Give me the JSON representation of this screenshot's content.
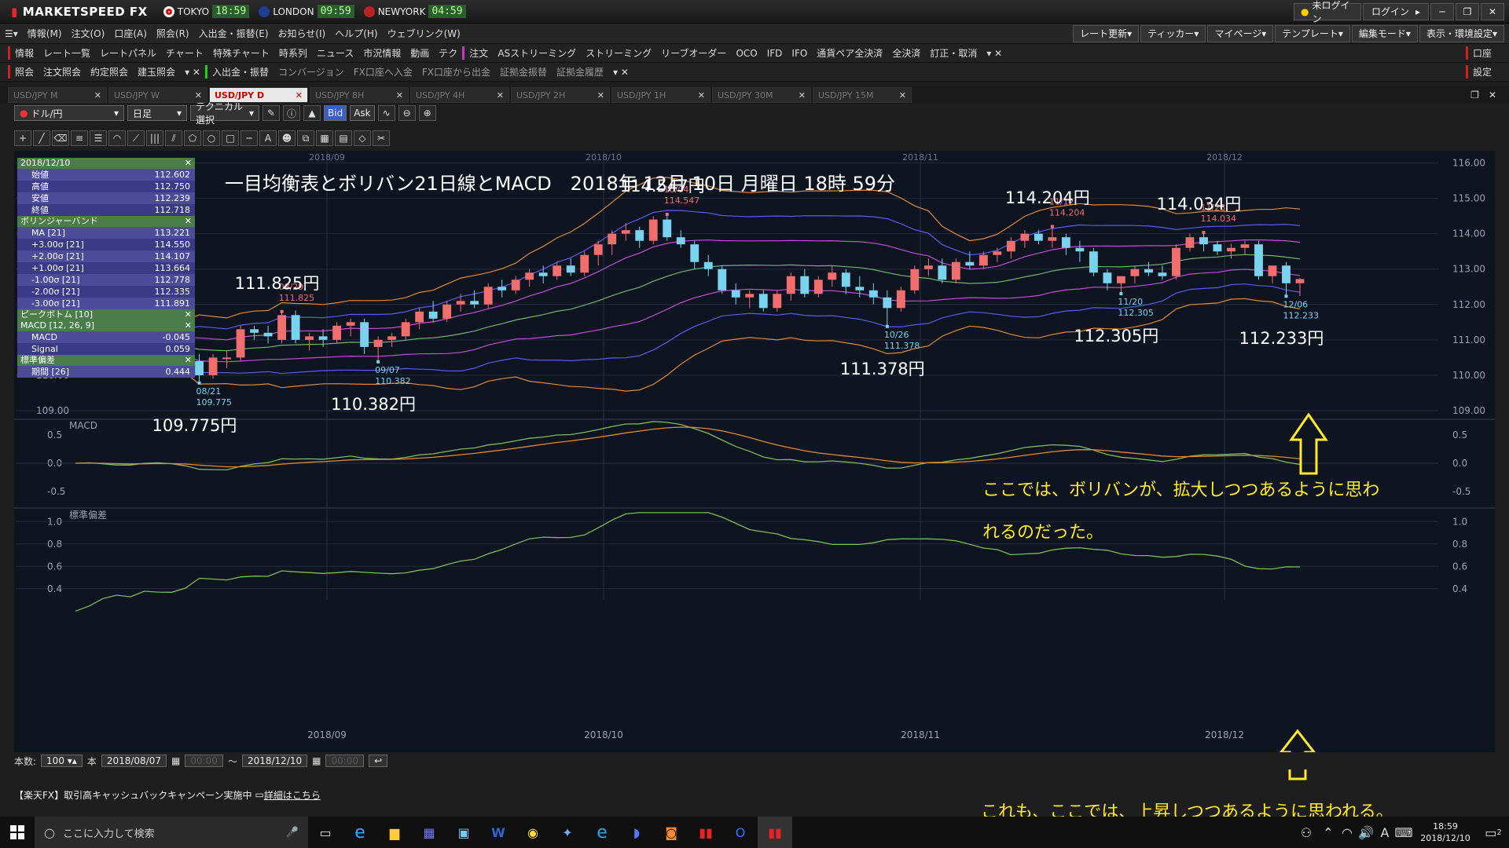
{
  "titlebar": {
    "app": "MARKETSPEED FX",
    "cities": [
      {
        "name": "TOKYO",
        "time": "18:59"
      },
      {
        "name": "LONDON",
        "time": "09:59"
      },
      {
        "name": "NEWYORK",
        "time": "04:59"
      }
    ],
    "login_status": "未ログイン",
    "login": "ログイン"
  },
  "menu": [
    "情報(M)",
    "注文(O)",
    "口座(A)",
    "照会(R)",
    "入出金・振替(E)",
    "お知らせ(I)",
    "ヘルプ(H)",
    "ウェブリンク(W)"
  ],
  "menu_right": [
    "レート更新",
    "ティッカー",
    "マイページ",
    "テンプレート",
    "編集モード",
    "表示・環境設定"
  ],
  "toolbar2": [
    "情報",
    "レート一覧",
    "レートパネル",
    "チャート",
    "特殊チャート",
    "時系列",
    "ニュース",
    "市況情報",
    "動画",
    "テク",
    "注文",
    "ASストリーミング",
    "ストリーミング",
    "リーブオーダー",
    "OCO",
    "IFD",
    "IFO",
    "通貨ペア全決済",
    "全決済",
    "訂正・取消"
  ],
  "toolbar2_right": "口座",
  "toolbar3": [
    "照会",
    "注文照会",
    "約定照会",
    "建玉照会",
    "入出金・振替",
    "コンバージョン",
    "FX口座へ入金",
    "FX口座から出金",
    "証拠金振替",
    "証拠金履歴"
  ],
  "toolbar3_right": "設定",
  "tabs": [
    "USD/JPY M",
    "USD/JPY W",
    "USD/JPY D",
    "USD/JPY 8H",
    "USD/JPY 4H",
    "USD/JPY 2H",
    "USD/JPY 1H",
    "USD/JPY 30M",
    "USD/JPY 15M"
  ],
  "active_tab": 2,
  "chart_toolbar": {
    "pair": "ドル/円",
    "period": "日足",
    "tech": "テクニカル選択",
    "bid": "Bid",
    "ask": "Ask"
  },
  "heading": "一目均衡表とボリバン21日線とMACD　2018年 12月 10日 月曜日 18時 59分",
  "info": {
    "date": "2018/12/10",
    "ohlc": [
      [
        "始値",
        "112.602"
      ],
      [
        "高値",
        "112.750"
      ],
      [
        "安値",
        "112.239"
      ],
      [
        "終値",
        "112.718"
      ]
    ],
    "bb_title": "ボリンジャーバンド",
    "bb": [
      [
        "MA [21]",
        "113.221"
      ],
      [
        "+3.00σ [21]",
        "114.550"
      ],
      [
        "+2.00σ [21]",
        "114.107"
      ],
      [
        "+1.00σ [21]",
        "113.664"
      ],
      [
        "-1.00σ [21]",
        "112.778"
      ],
      [
        "-2.00σ [21]",
        "112.335"
      ],
      [
        "-3.00σ [21]",
        "111.891"
      ]
    ],
    "pb_title": "ピークボトム [10]",
    "macd_title": "MACD [12, 26, 9]",
    "macd": [
      [
        "MACD",
        "-0.045"
      ],
      [
        "Signal",
        "0.059"
      ]
    ],
    "sd_title": "標準偏差",
    "sd": [
      [
        "期間 [26]",
        "0.444"
      ]
    ]
  },
  "x_labels": [
    "2018/09",
    "2018/10",
    "2018/11",
    "2018/12"
  ],
  "price_ticks": [
    "116.00",
    "115.00",
    "114.00",
    "113.00",
    "112.00",
    "111.00",
    "110.00",
    "109.00"
  ],
  "macd_label": "MACD",
  "macd_ticks": [
    "0.5",
    "0.0",
    "-0.5"
  ],
  "sd_label": "標準偏差",
  "sd_ticks": [
    "1.0",
    "0.8",
    "0.6",
    "0.4"
  ],
  "peaks": [
    {
      "big": "109.775円",
      "date": "08/21",
      "val": "109.775",
      "type": "low"
    },
    {
      "big": "111.825円",
      "date": "08/29",
      "val": "111.825",
      "type": "high"
    },
    {
      "big": "110.382円",
      "date": "09/07",
      "val": "110.382",
      "type": "low"
    },
    {
      "big": "114.547円",
      "date": "10/04",
      "val": "114.547",
      "type": "high"
    },
    {
      "big": "111.378円",
      "date": "10/26",
      "val": "111.378",
      "type": "low"
    },
    {
      "big": "114.204円",
      "date": "11/12",
      "val": "114.204",
      "type": "high"
    },
    {
      "big": "112.305円",
      "date": "11/20",
      "val": "112.305",
      "type": "low"
    },
    {
      "big": "114.034円",
      "date": "11/28",
      "val": "114.034",
      "type": "high"
    },
    {
      "big": "112.233円",
      "date": "12/06",
      "val": "112.233",
      "type": "low"
    }
  ],
  "annot1": "ここでは、ボリバンが、拡大しつつあるように思わ",
  "annot1b": "れるのだった。",
  "annot2": "これも、ここでは、上昇しつつあるように思われる。",
  "status": {
    "count_label": "本数:",
    "count": "100",
    "unit": "本",
    "from": "2018/08/07",
    "to": "2018/12/10",
    "tilde": "〜"
  },
  "news": "【楽天FX】取引高キャッシュバックキャンペーン実施中",
  "news_link": "詳細はこちら",
  "taskbar": {
    "search": "ここに入力して検索",
    "time": "18:59",
    "date": "2018/12/10",
    "notif": "2"
  },
  "colors": {
    "up": "#f06e6e",
    "down": "#7ad3ee",
    "ma": "#6fb56f",
    "s1": "#c34fd8",
    "s2": "#5b5bf0",
    "s3": "#e08a37",
    "macd": "#7bbd5a",
    "signal": "#e08a37",
    "sd": "#7bbd5a",
    "annot": "#ffea2e"
  },
  "chart_data": {
    "type": "candlestick",
    "title": "一目均衡表とボリバン21日線とMACD　2018年 12月 10日 月曜日 18時 59分",
    "ylim": [
      108.8,
      116.3
    ],
    "candles": [
      [
        111.1,
        111.3,
        110.8,
        110.9
      ],
      [
        110.9,
        111.2,
        110.7,
        111.0
      ],
      [
        111.0,
        111.2,
        110.5,
        110.7
      ],
      [
        110.7,
        111.0,
        110.3,
        110.6
      ],
      [
        110.6,
        110.9,
        110.3,
        110.8
      ],
      [
        110.8,
        111.3,
        110.6,
        111.2
      ],
      [
        111.2,
        111.4,
        110.9,
        111.0
      ],
      [
        111.0,
        111.2,
        110.4,
        110.7
      ],
      [
        110.7,
        110.9,
        110.2,
        110.4
      ],
      [
        110.4,
        110.6,
        109.78,
        110.0
      ],
      [
        110.0,
        110.6,
        109.9,
        110.5
      ],
      [
        110.5,
        110.7,
        110.2,
        110.5
      ],
      [
        110.5,
        111.4,
        110.4,
        111.3
      ],
      [
        111.3,
        111.4,
        111.0,
        111.2
      ],
      [
        111.2,
        111.4,
        110.9,
        111.1
      ],
      [
        111.0,
        111.8,
        110.9,
        111.7
      ],
      [
        111.7,
        111.83,
        110.9,
        111.0
      ],
      [
        111.0,
        111.2,
        110.7,
        111.1
      ],
      [
        111.1,
        111.3,
        110.8,
        111.0
      ],
      [
        111.0,
        111.5,
        110.9,
        111.4
      ],
      [
        111.4,
        111.6,
        111.1,
        111.5
      ],
      [
        111.5,
        111.6,
        110.6,
        110.8
      ],
      [
        110.8,
        111.1,
        110.38,
        111.0
      ],
      [
        111.0,
        111.2,
        110.8,
        111.1
      ],
      [
        111.1,
        111.6,
        111.0,
        111.5
      ],
      [
        111.5,
        111.9,
        111.3,
        111.8
      ],
      [
        111.8,
        112.1,
        111.5,
        111.6
      ],
      [
        111.6,
        112.1,
        111.5,
        112.0
      ],
      [
        112.0,
        112.3,
        111.8,
        112.1
      ],
      [
        112.1,
        112.4,
        111.9,
        112.0
      ],
      [
        112.0,
        112.6,
        111.9,
        112.5
      ],
      [
        112.5,
        112.7,
        112.2,
        112.4
      ],
      [
        112.4,
        112.8,
        112.3,
        112.7
      ],
      [
        112.7,
        113.0,
        112.5,
        112.9
      ],
      [
        112.9,
        113.1,
        112.6,
        112.8
      ],
      [
        112.8,
        113.2,
        112.7,
        113.1
      ],
      [
        113.1,
        113.3,
        112.8,
        112.9
      ],
      [
        112.9,
        113.5,
        112.8,
        113.4
      ],
      [
        113.4,
        113.8,
        113.1,
        113.7
      ],
      [
        113.7,
        114.1,
        113.4,
        114.0
      ],
      [
        114.0,
        114.3,
        113.8,
        114.1
      ],
      [
        114.1,
        114.2,
        113.6,
        113.8
      ],
      [
        113.8,
        114.5,
        113.7,
        114.4
      ],
      [
        114.4,
        114.547,
        113.8,
        113.9
      ],
      [
        113.9,
        114.1,
        113.6,
        113.7
      ],
      [
        113.7,
        113.8,
        113.0,
        113.2
      ],
      [
        113.2,
        113.4,
        112.8,
        113.0
      ],
      [
        113.0,
        113.1,
        112.3,
        112.4
      ],
      [
        112.4,
        112.6,
        112.0,
        112.2
      ],
      [
        112.2,
        112.4,
        111.9,
        112.3
      ],
      [
        112.3,
        112.4,
        111.8,
        111.9
      ],
      [
        111.9,
        112.4,
        111.8,
        112.3
      ],
      [
        112.3,
        112.9,
        112.1,
        112.8
      ],
      [
        112.8,
        113.0,
        112.2,
        112.3
      ],
      [
        112.3,
        112.8,
        112.2,
        112.7
      ],
      [
        112.7,
        113.1,
        112.5,
        112.9
      ],
      [
        112.9,
        113.0,
        112.3,
        112.5
      ],
      [
        112.5,
        112.8,
        112.2,
        112.4
      ],
      [
        112.4,
        112.6,
        112.0,
        112.2
      ],
      [
        112.2,
        112.4,
        111.378,
        111.9
      ],
      [
        111.9,
        112.5,
        111.8,
        112.4
      ],
      [
        112.4,
        113.1,
        112.3,
        113.0
      ],
      [
        113.0,
        113.3,
        112.8,
        113.1
      ],
      [
        113.1,
        113.3,
        112.6,
        112.7
      ],
      [
        112.7,
        113.3,
        112.6,
        113.2
      ],
      [
        113.2,
        113.5,
        113.0,
        113.1
      ],
      [
        113.1,
        113.5,
        113.0,
        113.4
      ],
      [
        113.4,
        113.6,
        113.2,
        113.5
      ],
      [
        113.5,
        113.9,
        113.3,
        113.8
      ],
      [
        113.8,
        114.1,
        113.6,
        114.0
      ],
      [
        114.0,
        114.1,
        113.7,
        113.8
      ],
      [
        113.8,
        114.204,
        113.6,
        113.9
      ],
      [
        113.9,
        114.0,
        113.4,
        113.6
      ],
      [
        113.6,
        113.8,
        113.2,
        113.5
      ],
      [
        113.5,
        113.6,
        112.8,
        112.9
      ],
      [
        112.9,
        113.0,
        112.4,
        112.6
      ],
      [
        112.6,
        112.8,
        112.305,
        112.8
      ],
      [
        112.8,
        113.1,
        112.6,
        113.0
      ],
      [
        113.0,
        113.2,
        112.8,
        112.9
      ],
      [
        112.9,
        113.1,
        112.7,
        112.8
      ],
      [
        112.8,
        113.7,
        112.7,
        113.6
      ],
      [
        113.6,
        114.0,
        113.5,
        113.9
      ],
      [
        113.9,
        114.034,
        113.5,
        113.7
      ],
      [
        113.7,
        113.8,
        113.4,
        113.5
      ],
      [
        113.5,
        113.7,
        113.3,
        113.6
      ],
      [
        113.6,
        113.8,
        113.4,
        113.7
      ],
      [
        113.7,
        113.8,
        112.7,
        112.8
      ],
      [
        112.8,
        113.1,
        112.6,
        113.1
      ],
      [
        113.1,
        113.2,
        112.233,
        112.6
      ],
      [
        112.6,
        112.75,
        112.239,
        112.718
      ]
    ]
  }
}
